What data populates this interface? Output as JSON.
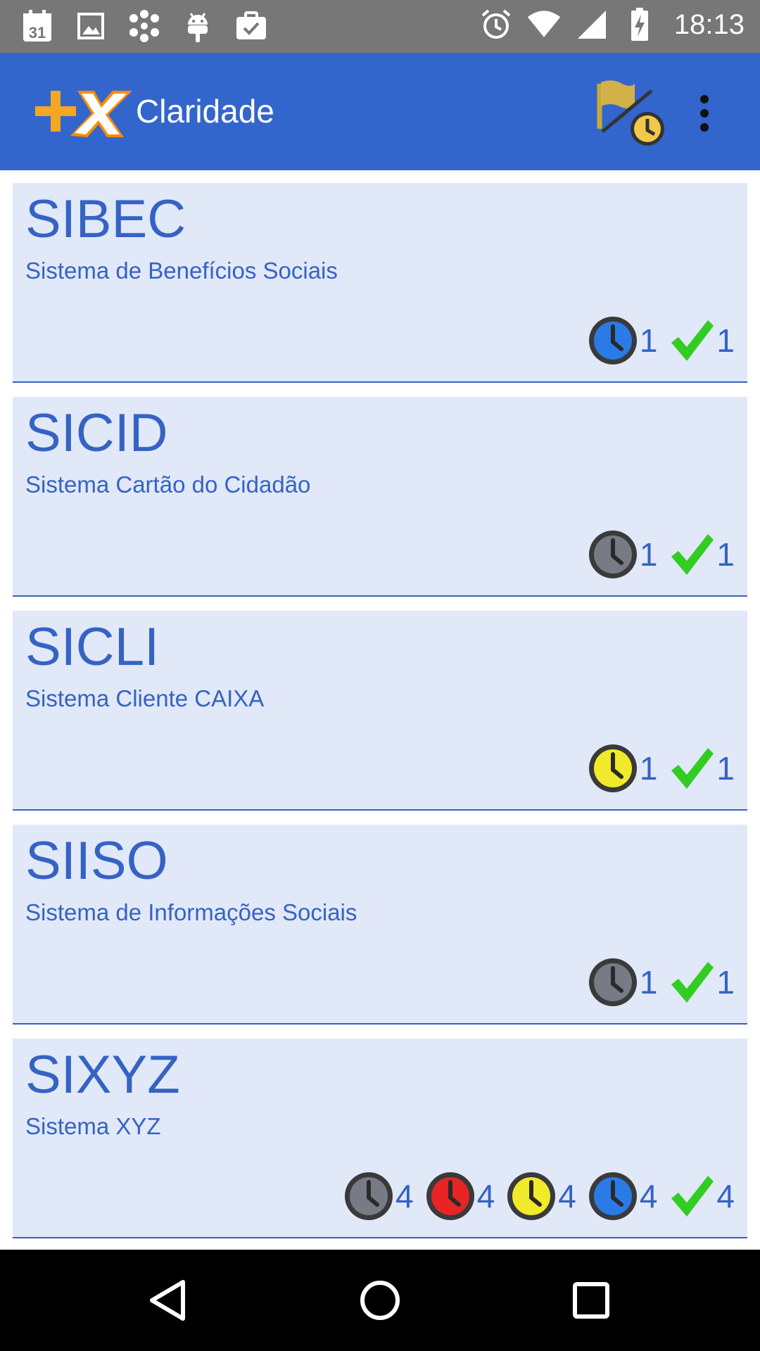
{
  "status_bar": {
    "time": "18:13",
    "calendar_day": "31",
    "left_icons": [
      "calendar-icon",
      "image-icon",
      "dots-icon",
      "android-icon",
      "briefcase-check-icon"
    ],
    "right_icons": [
      "alarm-icon",
      "wifi-icon",
      "signal-icon",
      "battery-charging-icon"
    ]
  },
  "app_bar": {
    "title": "Claridade",
    "actions": [
      "flag-clock-icon",
      "overflow-menu-icon"
    ]
  },
  "colors": {
    "app_bar": "#3366cc",
    "card_bg": "#e1e8f8",
    "text_blue": "#3563c4",
    "clock_gray": "#777b86",
    "clock_blue": "#2a7be8",
    "clock_yellow": "#f0ea2a",
    "clock_red": "#e82424",
    "check_green": "#33cc22"
  },
  "systems": [
    {
      "code": "SIBEC",
      "name": "Sistema de Benefícios Sociais",
      "badges": [
        {
          "icon": "clock-blue-icon",
          "color": "blue",
          "count": "1"
        },
        {
          "icon": "check-icon",
          "color": "green",
          "count": "1"
        }
      ]
    },
    {
      "code": "SICID",
      "name": "Sistema Cartão do Cidadão",
      "badges": [
        {
          "icon": "clock-gray-icon",
          "color": "gray",
          "count": "1"
        },
        {
          "icon": "check-icon",
          "color": "green",
          "count": "1"
        }
      ]
    },
    {
      "code": "SICLI",
      "name": "Sistema Cliente CAIXA",
      "badges": [
        {
          "icon": "clock-yellow-icon",
          "color": "yellow",
          "count": "1"
        },
        {
          "icon": "check-icon",
          "color": "green",
          "count": "1"
        }
      ]
    },
    {
      "code": "SIISO",
      "name": "Sistema de Informações Sociais",
      "badges": [
        {
          "icon": "clock-gray-icon",
          "color": "gray",
          "count": "1"
        },
        {
          "icon": "check-icon",
          "color": "green",
          "count": "1"
        }
      ]
    },
    {
      "code": "SIXYZ",
      "name": "Sistema XYZ",
      "badges": [
        {
          "icon": "clock-gray-icon",
          "color": "gray",
          "count": "4"
        },
        {
          "icon": "clock-red-icon",
          "color": "red",
          "count": "4"
        },
        {
          "icon": "clock-yellow-icon",
          "color": "yellow",
          "count": "4"
        },
        {
          "icon": "clock-blue-icon",
          "color": "blue",
          "count": "4"
        },
        {
          "icon": "check-icon",
          "color": "green",
          "count": "4"
        }
      ]
    }
  ],
  "nav_bar": {
    "buttons": [
      "back-icon",
      "home-icon",
      "recents-icon"
    ]
  }
}
